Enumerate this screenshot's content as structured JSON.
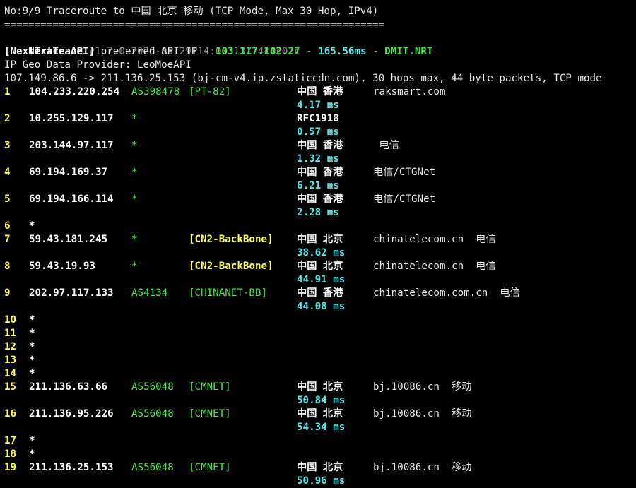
{
  "window": {
    "title": "No:9/9 Traceroute to 中国 北京 移动 (TCP Mode, Max 30 Hop, IPv4)",
    "separator": "==============================================================="
  },
  "header": {
    "app_name": "NextTrace",
    "version_info": "v1.7.0 2026-05-29T14:00:13Z 4c4c07c",
    "api_label": "[NextTrace API]",
    "api_text": " preferred API IP - ",
    "api_ip": "103.117.102.27",
    "api_dash1": " - ",
    "api_latency": "165.56ms",
    "api_dash2": " - ",
    "api_node": "DMIT.NRT",
    "geo_provider": "IP Geo Data Provider: LeoMoeAPI",
    "route_summary": "107.149.86.6 -> 211.136.25.153 (bj-cm-v4.ip.zstaticcdn.com), 30 hops max, 44 byte packets, TCP mode"
  },
  "hops": [
    {
      "num": "1",
      "ip": "104.233.220.254",
      "asn": "AS398478",
      "tag": "[PT-82]",
      "tag_color": "green",
      "geo": "中国 香港",
      "host": "raksmart.com",
      "latency": "4.17 ms"
    },
    {
      "num": "2",
      "ip": "10.255.129.117",
      "asn": "*",
      "tag": "",
      "tag_color": "",
      "geo": "RFC1918",
      "host": "",
      "latency": "0.57 ms"
    },
    {
      "num": "3",
      "ip": "203.144.97.117",
      "asn": "*",
      "tag": "",
      "tag_color": "",
      "geo": "中国 香港",
      "host": " 电信",
      "latency": "1.32 ms"
    },
    {
      "num": "4",
      "ip": "69.194.169.37",
      "asn": "*",
      "tag": "",
      "tag_color": "",
      "geo": "中国 香港",
      "host": "电信/CTGNet",
      "latency": "6.21 ms"
    },
    {
      "num": "5",
      "ip": "69.194.166.114",
      "asn": "*",
      "tag": "",
      "tag_color": "",
      "geo": "中国 香港",
      "host": "电信/CTGNet",
      "latency": "2.28 ms"
    },
    {
      "num": "6",
      "ip": "*"
    },
    {
      "num": "7",
      "ip": "59.43.181.245",
      "asn": "*",
      "tag": "[CN2-BackBone]",
      "tag_color": "yellow",
      "geo": "中国 北京",
      "host": "chinatelecom.cn  电信",
      "latency": "38.62 ms"
    },
    {
      "num": "8",
      "ip": "59.43.19.93",
      "asn": "*",
      "tag": "[CN2-BackBone]",
      "tag_color": "yellow",
      "geo": "中国 北京",
      "host": "chinatelecom.cn  电信",
      "latency": "44.91 ms"
    },
    {
      "num": "9",
      "ip": "202.97.117.133",
      "asn": "AS4134",
      "tag": "[CHINANET-BB]",
      "tag_color": "green",
      "geo": "中国 香港",
      "host": "chinatelecom.com.cn  电信",
      "latency": "44.08 ms"
    },
    {
      "num": "10",
      "ip": "*"
    },
    {
      "num": "11",
      "ip": "*"
    },
    {
      "num": "12",
      "ip": "*"
    },
    {
      "num": "13",
      "ip": "*"
    },
    {
      "num": "14",
      "ip": "*"
    },
    {
      "num": "15",
      "ip": "211.136.63.66",
      "asn": "AS56048",
      "tag": "[CMNET]",
      "tag_color": "green",
      "geo": "中国 北京",
      "host": "bj.10086.cn  移动",
      "latency": "50.84 ms"
    },
    {
      "num": "16",
      "ip": "211.136.95.226",
      "asn": "AS56048",
      "tag": "[CMNET]",
      "tag_color": "green",
      "geo": "中国 北京",
      "host": "bj.10086.cn  移动",
      "latency": "54.34 ms"
    },
    {
      "num": "17",
      "ip": "*"
    },
    {
      "num": "18",
      "ip": "*"
    },
    {
      "num": "19",
      "ip": "211.136.25.153",
      "asn": "AS56048",
      "tag": "[CMNET]",
      "tag_color": "green",
      "geo": "中国 北京",
      "host": "bj.10086.cn  移动",
      "latency": "50.96 ms"
    }
  ]
}
